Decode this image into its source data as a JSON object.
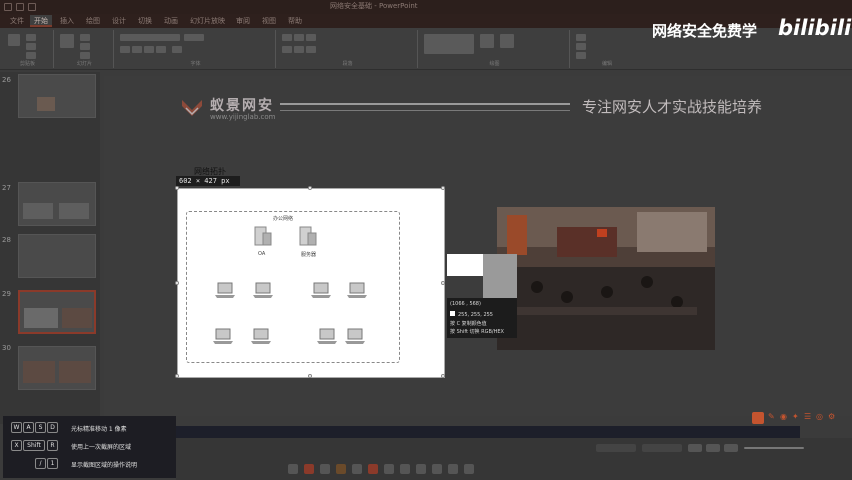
{
  "window": {
    "title": "网络安全基础 - PowerPoint"
  },
  "tabs": [
    "文件",
    "开始",
    "插入",
    "绘图",
    "设计",
    "切换",
    "动画",
    "幻灯片放映",
    "审阅",
    "视图",
    "帮助"
  ],
  "ribbon": {
    "groups": [
      "剪贴板",
      "幻灯片",
      "字体",
      "段落",
      "绘图",
      "编辑"
    ]
  },
  "watermark": {
    "text": "网络安全免费学",
    "brand": "bilibili"
  },
  "thumbnails": {
    "numbers": [
      "26",
      "27",
      "28",
      "29",
      "30"
    ]
  },
  "slide": {
    "logo_text": "蚁景网安",
    "logo_url": "www.yijinglab.com",
    "slogan": "专注网安人才实战技能培养"
  },
  "capture": {
    "size_label": "网络拓扑",
    "size_badge": "602 × 427  px",
    "net_title": "办公网络",
    "server_labels": [
      "OA",
      "服务器"
    ]
  },
  "magnifier": {
    "coords": "(1066 , 568)",
    "rgb": "255, 255, 255",
    "copy_hint": "按 C 复制颜色值",
    "shift_hint": "按 Shift 切换 RGB/HEX"
  },
  "shortcut_panel": {
    "rows": [
      {
        "keys": [
          "W",
          "A",
          "S",
          "D"
        ],
        "text": "光标精准移动 1 像素"
      },
      {
        "keys": [
          "X",
          "Shift",
          "R"
        ],
        "text": "使用上一次截屏的区域"
      },
      {
        "keys": [
          "/",
          "1"
        ],
        "text": "显示截图区域的操作说明"
      }
    ]
  },
  "colors": {
    "accent": "#8b3a2a",
    "brand_red": "#c4542f"
  }
}
